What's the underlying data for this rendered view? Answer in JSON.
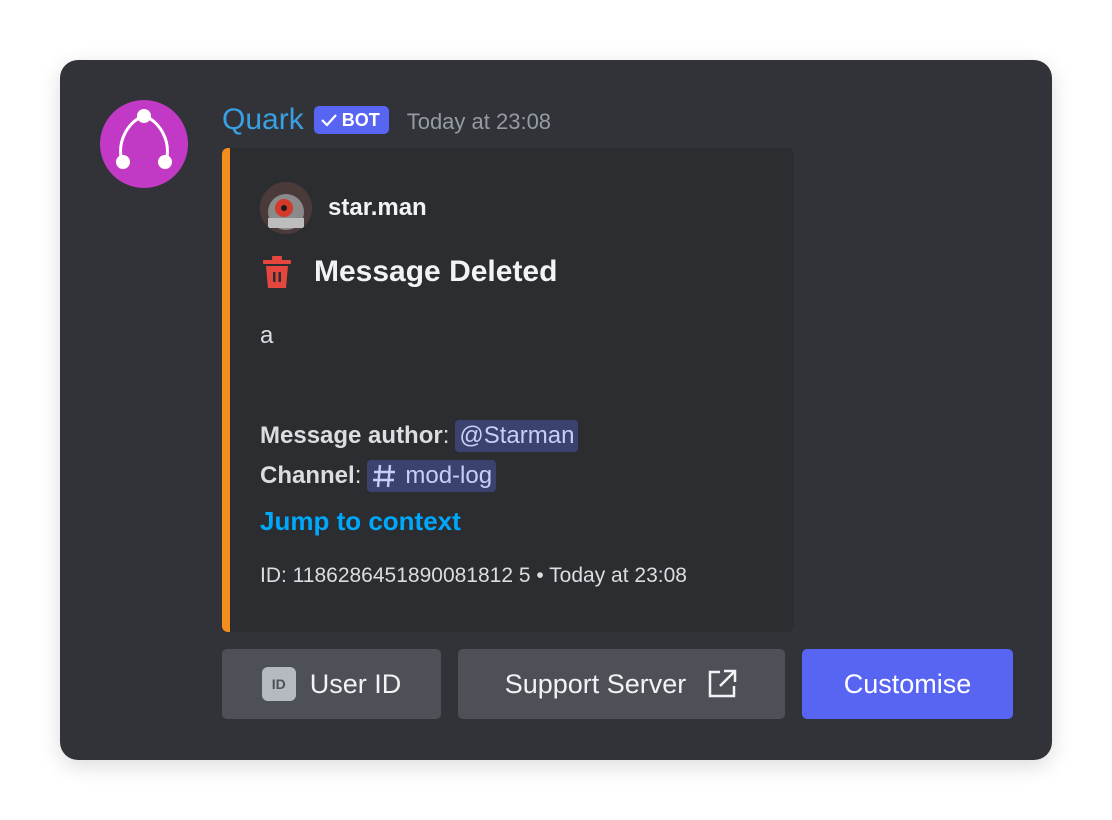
{
  "message": {
    "bot_name": "Quark",
    "bot_badge": "BOT",
    "timestamp": "Today at 23:08"
  },
  "embed": {
    "accent_color": "#f48c1e",
    "author_name": "star.man",
    "title": "Message Deleted",
    "title_icon": "trash-icon",
    "description": "a",
    "fields": {
      "author_label": "Message author",
      "author_value": "@Starman",
      "channel_label": "Channel",
      "channel_value": "mod-log"
    },
    "link_text": "Jump to context",
    "footer_text": "ID: 1186286451890081812 5 • Today at 23:08"
  },
  "buttons": {
    "user_id_icon": "ID",
    "user_id_label": "User ID",
    "support_label": "Support Server",
    "customise_label": "Customise"
  },
  "colors": {
    "background": "#313338",
    "embed_background": "#2b2d31",
    "bot_name": "#3aa0e4",
    "blurple": "#5865f2",
    "link": "#00a8fc",
    "danger": "#e5473e"
  }
}
